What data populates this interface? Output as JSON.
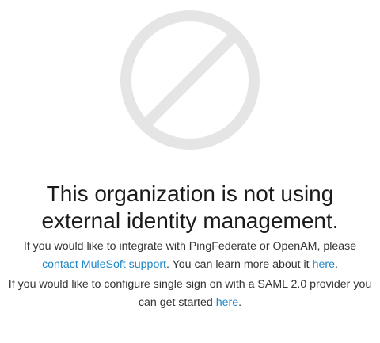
{
  "icon": {
    "name": "prohibited-icon",
    "color": "#e5e5e5"
  },
  "headline": {
    "line1": "This organization is not using",
    "line2": "external identity management."
  },
  "integrate": {
    "text_before": "If you would like to integrate with PingFederate or OpenAM, please",
    "support_link": "contact MuleSoft support",
    "text_middle": ". You can learn more about it ",
    "learn_more_link": "here",
    "text_end": "."
  },
  "saml": {
    "text_before": "If you would like to configure single sign on with a SAML 2.0 provider you can get started ",
    "start_link": "here",
    "text_end": "."
  },
  "colors": {
    "link": "#1e87c8",
    "text": "#333333",
    "heading": "#1a1a1a"
  }
}
